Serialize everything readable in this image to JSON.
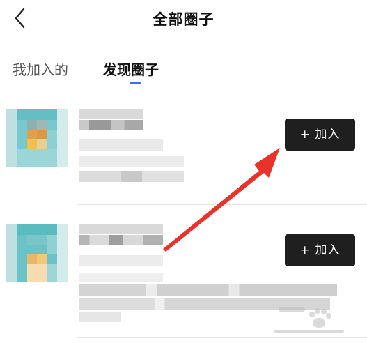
{
  "header": {
    "title": "全部圈子",
    "back_icon": "chevron-left-icon"
  },
  "tabs": [
    {
      "label": "我加入的",
      "active": false
    },
    {
      "label": "发现圈子",
      "active": true
    }
  ],
  "colors": {
    "accent": "#3d6cf0",
    "join_button_bg": "#1f1f1f",
    "arrow": "#e8322a"
  },
  "circles": [
    {
      "join_label": "+ 加入",
      "join_icon": "plus-icon"
    },
    {
      "join_label": "+ 加入",
      "join_icon": "plus-icon"
    }
  ],
  "annotation": {
    "arrow_icon": "red-arrow-icon"
  },
  "watermark": {
    "icon": "baidu-paw-icon"
  }
}
